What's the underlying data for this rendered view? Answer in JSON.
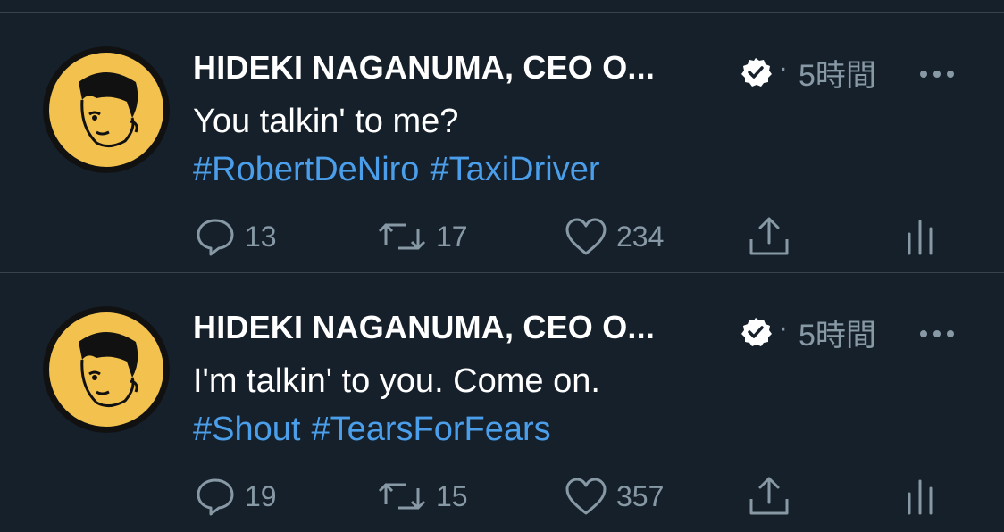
{
  "tweets": [
    {
      "author": "HIDEKI NAGANUMA, CEO O...",
      "separator": "·",
      "time": "5時間",
      "text": "You talkin' to me?",
      "hashtags": [
        "#RobertDeNiro",
        "#TaxiDriver"
      ],
      "replies": "13",
      "retweets": "17",
      "likes": "234"
    },
    {
      "author": "HIDEKI NAGANUMA, CEO O...",
      "separator": "·",
      "time": "5時間",
      "text": "I'm talkin' to you. Come on.",
      "hashtags": [
        "#Shout",
        "#TearsForFears"
      ],
      "replies": "19",
      "retweets": "15",
      "likes": "357"
    }
  ],
  "colors": {
    "background": "#15202b",
    "text": "#ffffff",
    "muted": "#8899a6",
    "hashtag": "#4a9eea",
    "divider": "#38444d",
    "avatar_fill": "#f2c14e"
  },
  "icons": [
    "verified-badge-icon",
    "more-icon",
    "reply-icon",
    "retweet-icon",
    "like-icon",
    "share-icon",
    "analytics-icon"
  ]
}
